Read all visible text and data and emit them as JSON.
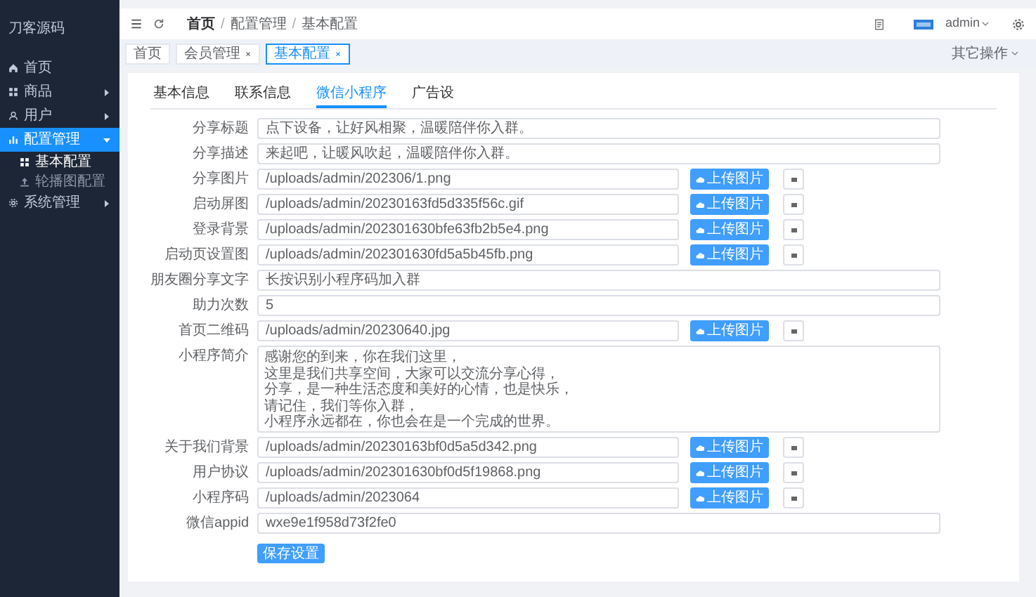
{
  "sidebar": {
    "title": "刀客源码",
    "items": [
      {
        "label": "首页",
        "selected": false
      },
      {
        "label": "商品",
        "expanded": false,
        "selected": false
      },
      {
        "label": "用户",
        "expanded": false,
        "selected": false
      },
      {
        "label": "配置管理",
        "expanded": true,
        "selected": true,
        "children": [
          {
            "label": "基本配置",
            "selected": true
          },
          {
            "label": "轮播图配置",
            "selected": false
          }
        ]
      },
      {
        "label": "系统管理",
        "expanded": false,
        "selected": false
      }
    ]
  },
  "header": {
    "breadcrumbs": [
      {
        "label": "首页"
      },
      {
        "separator": "/",
        "label": "配置管理"
      },
      {
        "separator": "/",
        "label": "基本配置"
      }
    ],
    "user": "admin"
  },
  "page_tabs": [
    {
      "label": "首页",
      "closable": false,
      "selected": false
    },
    {
      "label": "会员管理",
      "closable": true,
      "selected": false
    },
    {
      "label": "基本配置",
      "closable": true,
      "selected": true
    }
  ],
  "more_actions": "其它操作",
  "form_tabs": [
    {
      "label": "基本信息",
      "selected": false
    },
    {
      "label": "联系信息",
      "selected": false
    },
    {
      "label": "微信小程序",
      "selected": true
    },
    {
      "label": "广告设",
      "selected": false
    }
  ],
  "fields": [
    {
      "kind": "text",
      "label": "分享标题",
      "value": "点下设备，让好风相聚，温暖陪伴你入群。"
    },
    {
      "kind": "text",
      "label": "分享描述",
      "value": "来起吧，让暖风吹起，温暖陪伴你入群。"
    },
    {
      "kind": "upload",
      "label": "分享图片",
      "value": "/uploads/admin/202306/1.png",
      "button": "上传图片"
    },
    {
      "kind": "upload",
      "label": "启动屏图",
      "value": "/uploads/admin/20230163fd5d335f56c.gif",
      "button": "上传图片"
    },
    {
      "kind": "upload",
      "label": "登录背景",
      "value": "/uploads/admin/202301630bfe63fb2b5e4.png",
      "button": "上传图片"
    },
    {
      "kind": "upload",
      "label": "启动页设置图",
      "value": "/uploads/admin/202301630fd5a5b45fb.png",
      "button": "上传图片"
    },
    {
      "kind": "text",
      "label": "朋友圈分享文字",
      "value": "长按识别小程序码加入群"
    },
    {
      "kind": "text",
      "label": "助力次数",
      "value": "5"
    },
    {
      "kind": "upload",
      "label": "首页二维码",
      "value": "/uploads/admin/20230640.jpg",
      "button": "上传图片"
    },
    {
      "kind": "textarea",
      "label": "小程序简介",
      "lines": [
        "感谢您的到来，你在我们这里，",
        "这里是我们共享空间，大家可以交流分享心得，",
        "分享，是一种生活态度和美好的心情，也是快乐，",
        "请记住，我们等你入群，",
        "小程序永远都在，你也会在是一个完成的世界。"
      ]
    },
    {
      "kind": "upload",
      "label": "关于我们背景",
      "value": "/uploads/admin/20230163bf0d5a5d342.png",
      "button": "上传图片"
    },
    {
      "kind": "upload",
      "label": "用户协议",
      "value": "/uploads/admin/202301630bf0d5f19868.png",
      "button": "上传图片"
    },
    {
      "kind": "upload",
      "label": "小程序码",
      "value": "/uploads/admin/2023064",
      "button": "上传图片"
    },
    {
      "kind": "text",
      "label": "微信appid",
      "value": "wxe9e1f958d73f2fe0"
    }
  ],
  "save_button": "保存设置"
}
